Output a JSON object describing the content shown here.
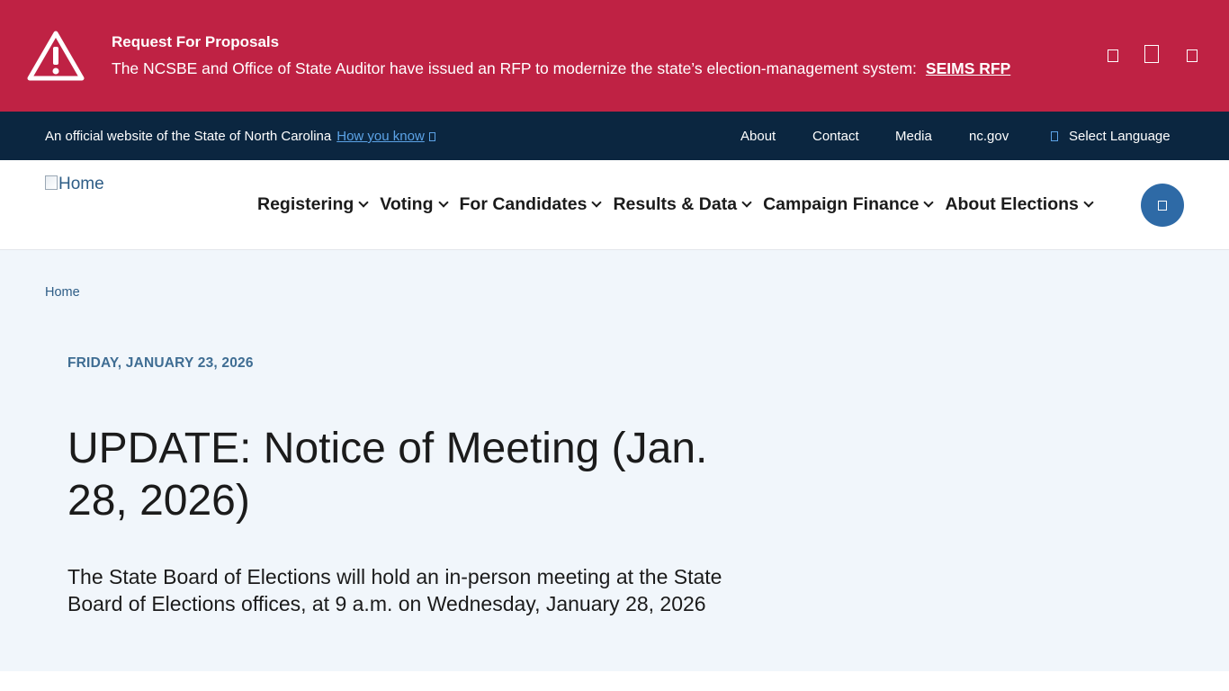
{
  "alert": {
    "icon": "warning-triangle-icon",
    "title": "Request For Proposals",
    "text": "The NCSBE and Office of State Auditor have issued an RFP to modernize the state’s election-management system:",
    "link_label": "SEIMS RFP",
    "background": "#bf2244"
  },
  "utility": {
    "official_text": "An official website of the State of North Carolina",
    "how_you_know": "How you know",
    "links": [
      "About",
      "Contact",
      "Media",
      "nc.gov"
    ],
    "language_label": "Select Language",
    "background": "#0b2640"
  },
  "header": {
    "logo_alt": "Home",
    "nav": [
      "Registering",
      "Voting",
      "For Candidates",
      "Results & Data",
      "Campaign Finance",
      "About Elections"
    ],
    "search_icon": "search-icon",
    "accent": "#2e6aa6"
  },
  "main": {
    "breadcrumb": "Home",
    "date": "FRIDAY, JANUARY 23, 2026",
    "title": "UPDATE: Notice of Meeting (Jan. 28, 2026)",
    "lead": "The State Board of Elections will hold an in-person meeting at the State Board of Elections offices, at 9 a.m. on Wednesday, January 28, 2026",
    "background": "#f1f6fb"
  }
}
